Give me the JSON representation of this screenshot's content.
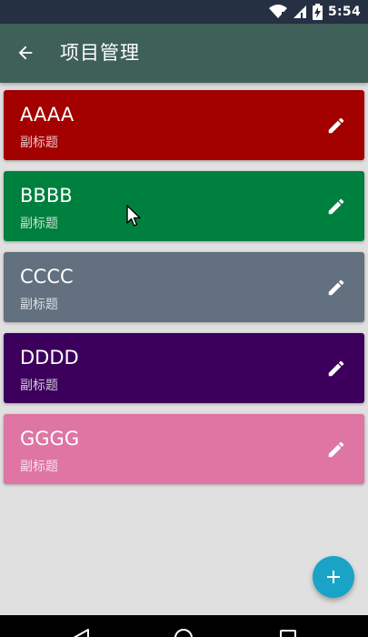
{
  "status_bar": {
    "time": "5:54",
    "icons": [
      "wifi-icon",
      "cell-signal-icon",
      "battery-charging-icon"
    ]
  },
  "app_bar": {
    "back_icon": "arrow-back-icon",
    "title": "项目管理"
  },
  "projects": [
    {
      "title": "AAAA",
      "subtitle": "副标题",
      "color": "#a30000"
    },
    {
      "title": "BBBB",
      "subtitle": "副标题",
      "color": "#00803e"
    },
    {
      "title": "CCCC",
      "subtitle": "副标题",
      "color": "#627080"
    },
    {
      "title": "DDDD",
      "subtitle": "副标题",
      "color": "#3c005c"
    },
    {
      "title": "GGGG",
      "subtitle": "副标题",
      "color": "#de75a3"
    }
  ],
  "fab": {
    "icon": "plus-icon",
    "color": "#19a3c6"
  },
  "nav_bar": {
    "icons": [
      "back-triangle-icon",
      "home-circle-icon",
      "recents-square-icon"
    ]
  }
}
